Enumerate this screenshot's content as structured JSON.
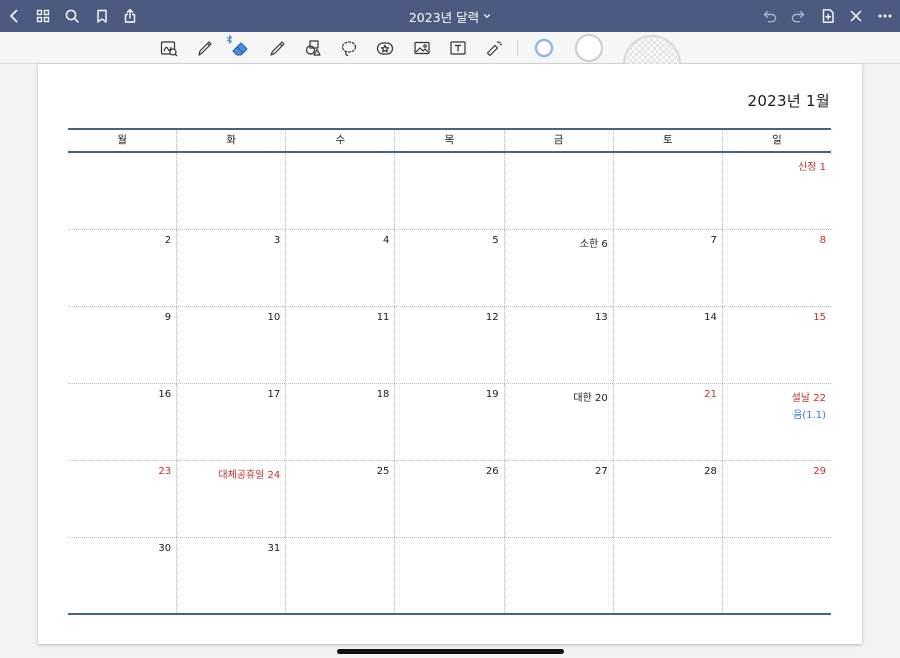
{
  "header": {
    "title": "2023년 달력"
  },
  "page": {
    "title": "2023년  1월"
  },
  "calendar": {
    "weekdays": [
      "월",
      "화",
      "수",
      "목",
      "금",
      "토",
      "일"
    ],
    "weeks": [
      [
        {
          "label": ""
        },
        {
          "label": ""
        },
        {
          "label": ""
        },
        {
          "label": ""
        },
        {
          "label": ""
        },
        {
          "label": ""
        },
        {
          "label": "신정  1",
          "red": true
        }
      ],
      [
        {
          "label": "2"
        },
        {
          "label": "3"
        },
        {
          "label": "4"
        },
        {
          "label": "5"
        },
        {
          "label": "소한  6"
        },
        {
          "label": "7"
        },
        {
          "label": "8",
          "red": true
        }
      ],
      [
        {
          "label": "9"
        },
        {
          "label": "10"
        },
        {
          "label": "11"
        },
        {
          "label": "12"
        },
        {
          "label": "13"
        },
        {
          "label": "14"
        },
        {
          "label": "15",
          "red": true
        }
      ],
      [
        {
          "label": "16"
        },
        {
          "label": "17"
        },
        {
          "label": "18"
        },
        {
          "label": "19"
        },
        {
          "label": "대한  20"
        },
        {
          "label": "21",
          "red": true
        },
        {
          "label": "설날  22",
          "red": true,
          "sub": "음(1.1)"
        }
      ],
      [
        {
          "label": "23",
          "red": true
        },
        {
          "label": "대체공휴일  24",
          "red": true
        },
        {
          "label": "25"
        },
        {
          "label": "26"
        },
        {
          "label": "27"
        },
        {
          "label": "28"
        },
        {
          "label": "29",
          "red": true
        }
      ],
      [
        {
          "label": "30"
        },
        {
          "label": "31"
        },
        {
          "label": ""
        },
        {
          "label": ""
        },
        {
          "label": ""
        },
        {
          "label": ""
        },
        {
          "label": ""
        }
      ]
    ]
  },
  "colors": {
    "topbar": "#4c5a82",
    "holiday": "#c62f2f",
    "lunar": "#3a7cc6",
    "rule": "#47657a",
    "pen_active": "#8bb8e8"
  },
  "icons": {
    "back": "chevron-left-icon",
    "grid": "grid-icon",
    "search": "search-icon",
    "bookmark": "bookmark-icon",
    "share": "share-icon",
    "undo": "undo-icon",
    "redo": "redo-icon",
    "add_page": "add-page-icon",
    "close": "close-icon",
    "more": "more-icon"
  }
}
